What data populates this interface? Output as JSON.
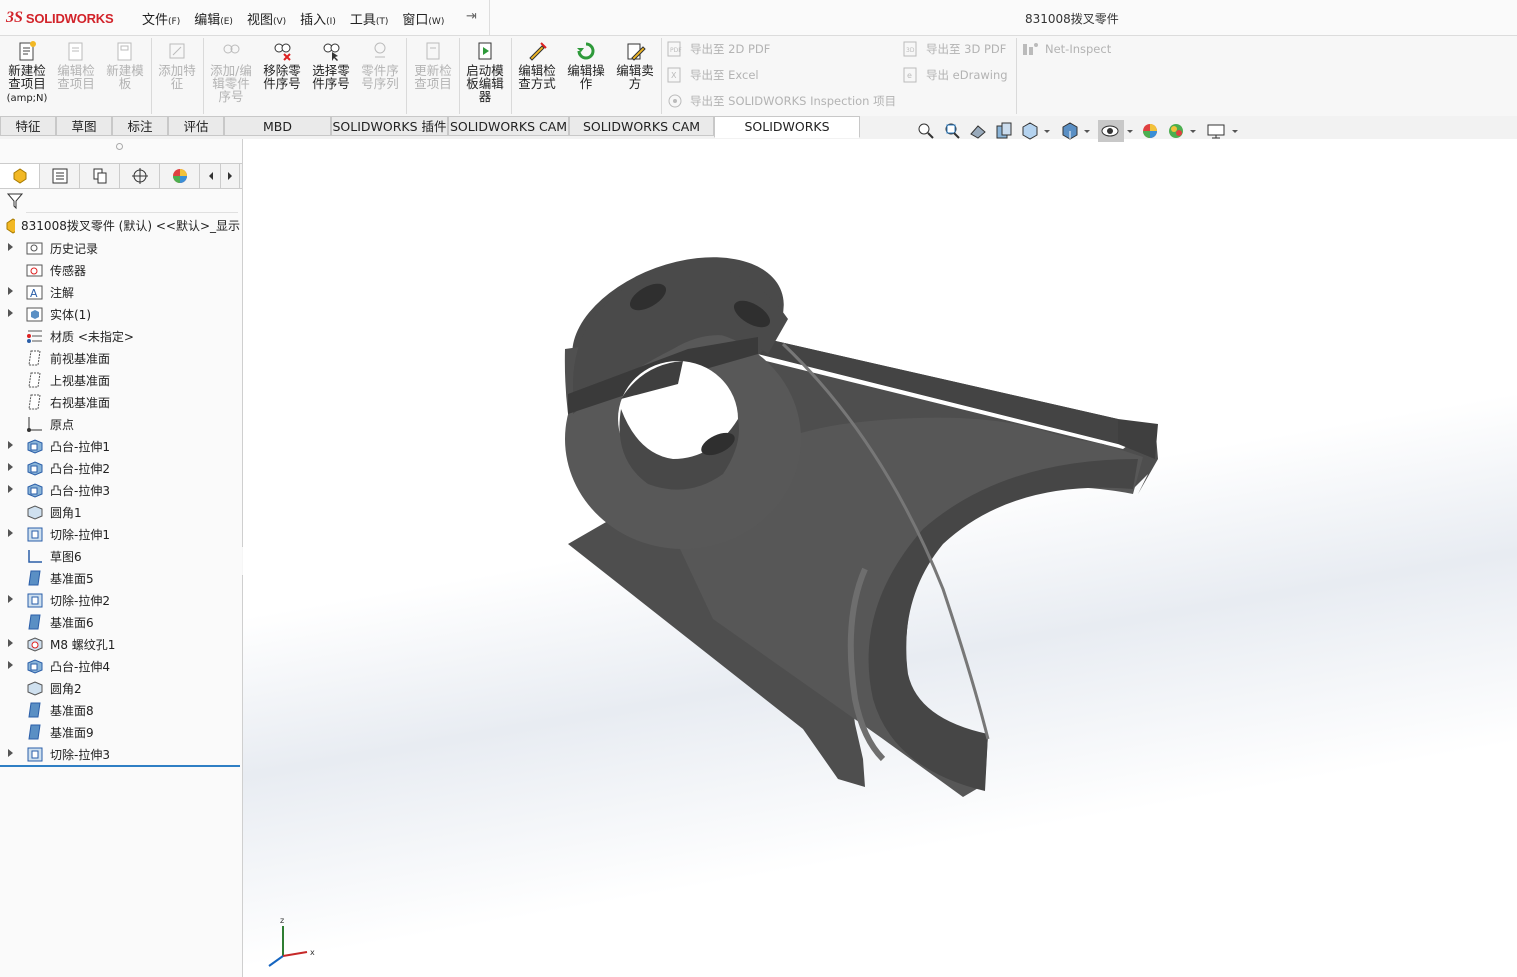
{
  "app": {
    "brand_mark": "3S",
    "brand_name": "SOLIDWORKS",
    "document_title": "831008拨叉零件"
  },
  "menu": [
    {
      "label": "文件",
      "key": "(F)"
    },
    {
      "label": "编辑",
      "key": "(E)"
    },
    {
      "label": "视图",
      "key": "(V)"
    },
    {
      "label": "插入",
      "key": "(I)"
    },
    {
      "label": "工具",
      "key": "(T)"
    },
    {
      "label": "窗口",
      "key": "(W)"
    }
  ],
  "toolbar": {
    "new_inspection": {
      "l1": "新建检",
      "l2": "查项目",
      "l3": "(amp;N)"
    },
    "edit_inspection": {
      "l1": "编辑检",
      "l2": "查项目"
    },
    "new_template": {
      "l1": "新建模",
      "l2": "板"
    },
    "add_feature": {
      "l1": "添加特",
      "l2": "征"
    },
    "add_edit_balloon": {
      "l1": "添加/编",
      "l2": "辑零件",
      "l3": "序号"
    },
    "remove_balloon": {
      "l1": "移除零",
      "l2": "件序号"
    },
    "select_balloon": {
      "l1": "选择零",
      "l2": "件序号"
    },
    "balloon_sequence": {
      "l1": "零件序",
      "l2": "号序列"
    },
    "update_inspection": {
      "l1": "更新检",
      "l2": "查项目"
    },
    "template_editor": {
      "l1": "启动模",
      "l2": "板编辑",
      "l3": "器"
    },
    "edit_method": {
      "l1": "编辑检",
      "l2": "查方式"
    },
    "edit_operation": {
      "l1": "编辑操",
      "l2": "作"
    },
    "edit_vendor": {
      "l1": "编辑卖",
      "l2": "方"
    },
    "export_2d_pdf": "导出至 2D PDF",
    "export_excel": "导出至 Excel",
    "export_inspection": "导出至 SOLIDWORKS Inspection 项目",
    "export_3d_pdf": "导出至 3D PDF",
    "export_edrawing": "导出 eDrawing",
    "net_inspect": "Net-Inspect"
  },
  "tabs": [
    "特征",
    "草图",
    "标注",
    "评估",
    "MBD Dimensions",
    "SOLIDWORKS 插件",
    "SOLIDWORKS CAM",
    "SOLIDWORKS CAM TBM",
    "SOLIDWORKS Inspection"
  ],
  "active_tab": "SOLIDWORKS Inspection",
  "tree": {
    "root": "831008拨叉零件 (默认) <<默认>_显示",
    "items": [
      {
        "label": "历史记录",
        "expandable": true,
        "icon": "history-folder-icon"
      },
      {
        "label": "传感器",
        "expandable": false,
        "icon": "sensor-icon"
      },
      {
        "label": "注解",
        "expandable": true,
        "icon": "annotation-icon"
      },
      {
        "label": "实体(1)",
        "expandable": true,
        "icon": "solid-bodies-icon"
      },
      {
        "label": "材质 <未指定>",
        "expandable": false,
        "icon": "material-icon"
      },
      {
        "label": "前视基准面",
        "expandable": false,
        "icon": "plane-icon"
      },
      {
        "label": "上视基准面",
        "expandable": false,
        "icon": "plane-icon"
      },
      {
        "label": "右视基准面",
        "expandable": false,
        "icon": "plane-icon"
      },
      {
        "label": "原点",
        "expandable": false,
        "icon": "origin-icon"
      },
      {
        "label": "凸台-拉伸1",
        "expandable": true,
        "icon": "boss-extrude-icon"
      },
      {
        "label": "凸台-拉伸2",
        "expandable": true,
        "icon": "boss-extrude-icon"
      },
      {
        "label": "凸台-拉伸3",
        "expandable": true,
        "icon": "boss-extrude-icon"
      },
      {
        "label": "圆角1",
        "expandable": false,
        "icon": "fillet-icon"
      },
      {
        "label": "切除-拉伸1",
        "expandable": true,
        "icon": "cut-extrude-icon"
      },
      {
        "label": "草图6",
        "expandable": false,
        "icon": "sketch-icon"
      },
      {
        "label": "基准面5",
        "expandable": false,
        "icon": "ref-plane-icon"
      },
      {
        "label": "切除-拉伸2",
        "expandable": true,
        "icon": "cut-extrude-icon"
      },
      {
        "label": "基准面6",
        "expandable": false,
        "icon": "ref-plane-icon"
      },
      {
        "label": "M8 螺纹孔1",
        "expandable": true,
        "icon": "hole-wizard-icon"
      },
      {
        "label": "凸台-拉伸4",
        "expandable": true,
        "icon": "boss-extrude-icon"
      },
      {
        "label": "圆角2",
        "expandable": false,
        "icon": "fillet-icon"
      },
      {
        "label": "基准面8",
        "expandable": false,
        "icon": "ref-plane-icon"
      },
      {
        "label": "基准面9",
        "expandable": false,
        "icon": "ref-plane-icon"
      },
      {
        "label": "切除-拉伸3",
        "expandable": true,
        "icon": "cut-extrude-icon"
      }
    ]
  },
  "triad": {
    "z": "z",
    "x": "x"
  },
  "colors": {
    "brand": "#d2232a",
    "model": "#555555",
    "accent": "#2f7fc4"
  }
}
